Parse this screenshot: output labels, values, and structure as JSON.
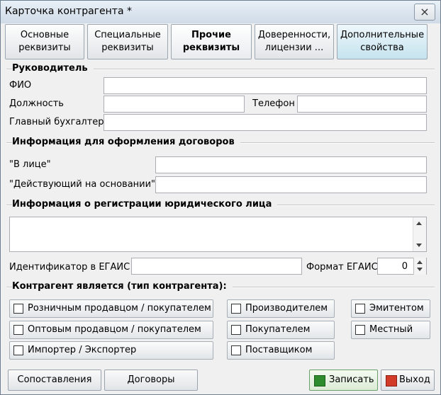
{
  "window": {
    "title": "Карточка контрагента *",
    "close_label": "×"
  },
  "tabs": [
    {
      "line1": "Основные",
      "line2": "реквизиты"
    },
    {
      "line1": "Специальные",
      "line2": "реквизиты"
    },
    {
      "line1": "Прочие",
      "line2": "реквизиты"
    },
    {
      "line1": "Доверенности,",
      "line2": "лицензии ..."
    },
    {
      "line1": "Дополнительные",
      "line2": "свойства"
    }
  ],
  "head": {
    "group": "Руководитель",
    "fio_label": "ФИО",
    "position_label": "Должность",
    "phone_label": "Телефон",
    "accountant_label": "Главный бухгалтер"
  },
  "contract": {
    "group": "Информация для оформления договоров",
    "in_person_label": "\"В лице\"",
    "acting_label": "\"Действующий на основании\""
  },
  "registration": {
    "group": "Информация о регистрации юридического лица",
    "egais_id_label": "Идентификатор в ЕГАИС",
    "egais_format_label": "Формат ЕГАИС",
    "egais_format_value": "0"
  },
  "types": {
    "group": "Контрагент является (тип контрагента):",
    "retail": "Розничным продавцом / покупателем",
    "wholesale": "Оптовым продавцом / покупателем",
    "importer": "Импортер / Экспортер",
    "producer": "Производителем",
    "buyer": "Покупателем",
    "supplier": "Поставщиком",
    "issuer": "Эмитентом",
    "local": "Местный"
  },
  "footer": {
    "mapping": "Сопоставления",
    "contracts": "Договоры",
    "save": "Записать",
    "exit": "Выход"
  }
}
